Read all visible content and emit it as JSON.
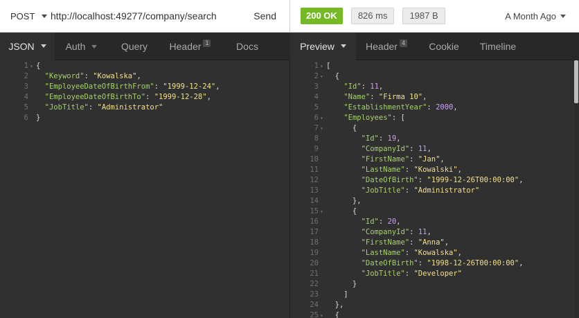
{
  "request": {
    "method": "POST",
    "url": "http://localhost:49277/company/search",
    "send_label": "Send",
    "tabs": [
      {
        "label": "JSON"
      },
      {
        "label": "Auth"
      },
      {
        "label": "Query"
      },
      {
        "label": "Header",
        "badge": "1"
      },
      {
        "label": "Docs"
      }
    ],
    "body_lines": [
      [
        [
          "p",
          "{"
        ]
      ],
      [
        [
          "p",
          "  "
        ],
        [
          "k",
          "\"Keyword\""
        ],
        [
          "p",
          ": "
        ],
        [
          "s",
          "\"Kowalska\""
        ],
        [
          "p",
          ","
        ]
      ],
      [
        [
          "p",
          "  "
        ],
        [
          "k",
          "\"EmployeeDateOfBirthFrom\""
        ],
        [
          "p",
          ": "
        ],
        [
          "s",
          "\"1999-12-24\""
        ],
        [
          "p",
          ","
        ]
      ],
      [
        [
          "p",
          "  "
        ],
        [
          "k",
          "\"EmployeeDateOfBirthTo\""
        ],
        [
          "p",
          ": "
        ],
        [
          "s",
          "\"1999-12-28\""
        ],
        [
          "p",
          ","
        ]
      ],
      [
        [
          "p",
          "  "
        ],
        [
          "k",
          "\"JobTitle\""
        ],
        [
          "p",
          ": "
        ],
        [
          "s",
          "\"Administrator\""
        ]
      ],
      [
        [
          "p",
          "}"
        ]
      ]
    ],
    "fold_lines": [
      1
    ]
  },
  "response": {
    "status": "200 OK",
    "time": "826 ms",
    "size": "1987 B",
    "history": "A Month Ago",
    "tabs": [
      {
        "label": "Preview"
      },
      {
        "label": "Header",
        "badge": "4"
      },
      {
        "label": "Cookie"
      },
      {
        "label": "Timeline"
      }
    ],
    "body_lines": [
      [
        [
          "p",
          "["
        ]
      ],
      [
        [
          "p",
          "  {"
        ]
      ],
      [
        [
          "p",
          "    "
        ],
        [
          "k",
          "\"Id\""
        ],
        [
          "p",
          ": "
        ],
        [
          "n",
          "11"
        ],
        [
          "p",
          ","
        ]
      ],
      [
        [
          "p",
          "    "
        ],
        [
          "k",
          "\"Name\""
        ],
        [
          "p",
          ": "
        ],
        [
          "s",
          "\"Firma 10\""
        ],
        [
          "p",
          ","
        ]
      ],
      [
        [
          "p",
          "    "
        ],
        [
          "k",
          "\"EstablishmentYear\""
        ],
        [
          "p",
          ": "
        ],
        [
          "n",
          "2000"
        ],
        [
          "p",
          ","
        ]
      ],
      [
        [
          "p",
          "    "
        ],
        [
          "k",
          "\"Employees\""
        ],
        [
          "p",
          ": ["
        ]
      ],
      [
        [
          "p",
          "      {"
        ]
      ],
      [
        [
          "p",
          "        "
        ],
        [
          "k",
          "\"Id\""
        ],
        [
          "p",
          ": "
        ],
        [
          "n",
          "19"
        ],
        [
          "p",
          ","
        ]
      ],
      [
        [
          "p",
          "        "
        ],
        [
          "k",
          "\"CompanyId\""
        ],
        [
          "p",
          ": "
        ],
        [
          "n",
          "11"
        ],
        [
          "p",
          ","
        ]
      ],
      [
        [
          "p",
          "        "
        ],
        [
          "k",
          "\"FirstName\""
        ],
        [
          "p",
          ": "
        ],
        [
          "s",
          "\"Jan\""
        ],
        [
          "p",
          ","
        ]
      ],
      [
        [
          "p",
          "        "
        ],
        [
          "k",
          "\"LastName\""
        ],
        [
          "p",
          ": "
        ],
        [
          "s",
          "\"Kowalski\""
        ],
        [
          "p",
          ","
        ]
      ],
      [
        [
          "p",
          "        "
        ],
        [
          "k",
          "\"DateOfBirth\""
        ],
        [
          "p",
          ": "
        ],
        [
          "s",
          "\"1999-12-26T00:00:00\""
        ],
        [
          "p",
          ","
        ]
      ],
      [
        [
          "p",
          "        "
        ],
        [
          "k",
          "\"JobTitle\""
        ],
        [
          "p",
          ": "
        ],
        [
          "s",
          "\"Administrator\""
        ]
      ],
      [
        [
          "p",
          "      },"
        ]
      ],
      [
        [
          "p",
          "      {"
        ]
      ],
      [
        [
          "p",
          "        "
        ],
        [
          "k",
          "\"Id\""
        ],
        [
          "p",
          ": "
        ],
        [
          "n",
          "20"
        ],
        [
          "p",
          ","
        ]
      ],
      [
        [
          "p",
          "        "
        ],
        [
          "k",
          "\"CompanyId\""
        ],
        [
          "p",
          ": "
        ],
        [
          "n",
          "11"
        ],
        [
          "p",
          ","
        ]
      ],
      [
        [
          "p",
          "        "
        ],
        [
          "k",
          "\"FirstName\""
        ],
        [
          "p",
          ": "
        ],
        [
          "s",
          "\"Anna\""
        ],
        [
          "p",
          ","
        ]
      ],
      [
        [
          "p",
          "        "
        ],
        [
          "k",
          "\"LastName\""
        ],
        [
          "p",
          ": "
        ],
        [
          "s",
          "\"Kowalska\""
        ],
        [
          "p",
          ","
        ]
      ],
      [
        [
          "p",
          "        "
        ],
        [
          "k",
          "\"DateOfBirth\""
        ],
        [
          "p",
          ": "
        ],
        [
          "s",
          "\"1998-12-26T00:00:00\""
        ],
        [
          "p",
          ","
        ]
      ],
      [
        [
          "p",
          "        "
        ],
        [
          "k",
          "\"JobTitle\""
        ],
        [
          "p",
          ": "
        ],
        [
          "s",
          "\"Developer\""
        ]
      ],
      [
        [
          "p",
          "      }"
        ]
      ],
      [
        [
          "p",
          "    ]"
        ]
      ],
      [
        [
          "p",
          "  },"
        ]
      ],
      [
        [
          "p",
          "  {"
        ]
      ]
    ],
    "fold_lines": [
      1,
      2,
      6,
      7,
      15,
      25
    ]
  },
  "colors": {
    "status_ok": "#75ba24",
    "json_key": "#a6d16d",
    "json_string": "#f2e08a",
    "json_number": "#c9a0f0"
  },
  "icons": [
    "caret-down-icon"
  ]
}
